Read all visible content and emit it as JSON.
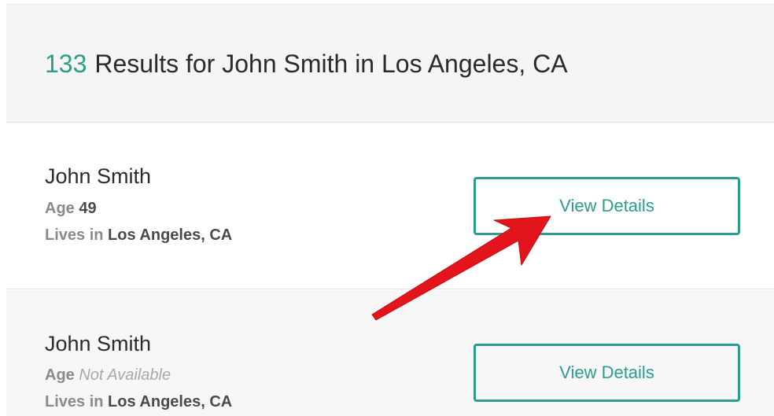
{
  "header": {
    "count": "133",
    "title_text": "Results for John Smith in Los Angeles, CA"
  },
  "results": [
    {
      "name": "John Smith",
      "age_label": "Age",
      "age_value": "49",
      "lives_label": "Lives in",
      "location": "Los Angeles, CA",
      "button_label": "View Details"
    },
    {
      "name": "John Smith",
      "age_label": "Age",
      "age_value": "Not Available",
      "lives_label": "Lives in",
      "location": "Los Angeles, CA",
      "button_label": "View Details"
    }
  ],
  "colors": {
    "accent": "#2a9d8f",
    "annotation_arrow": "#e3141b",
    "header_background": "#f5f5f5",
    "alternate_card_background": "#f7f7f7"
  },
  "icons": {
    "annotation": "red-pointer-arrow-icon"
  }
}
